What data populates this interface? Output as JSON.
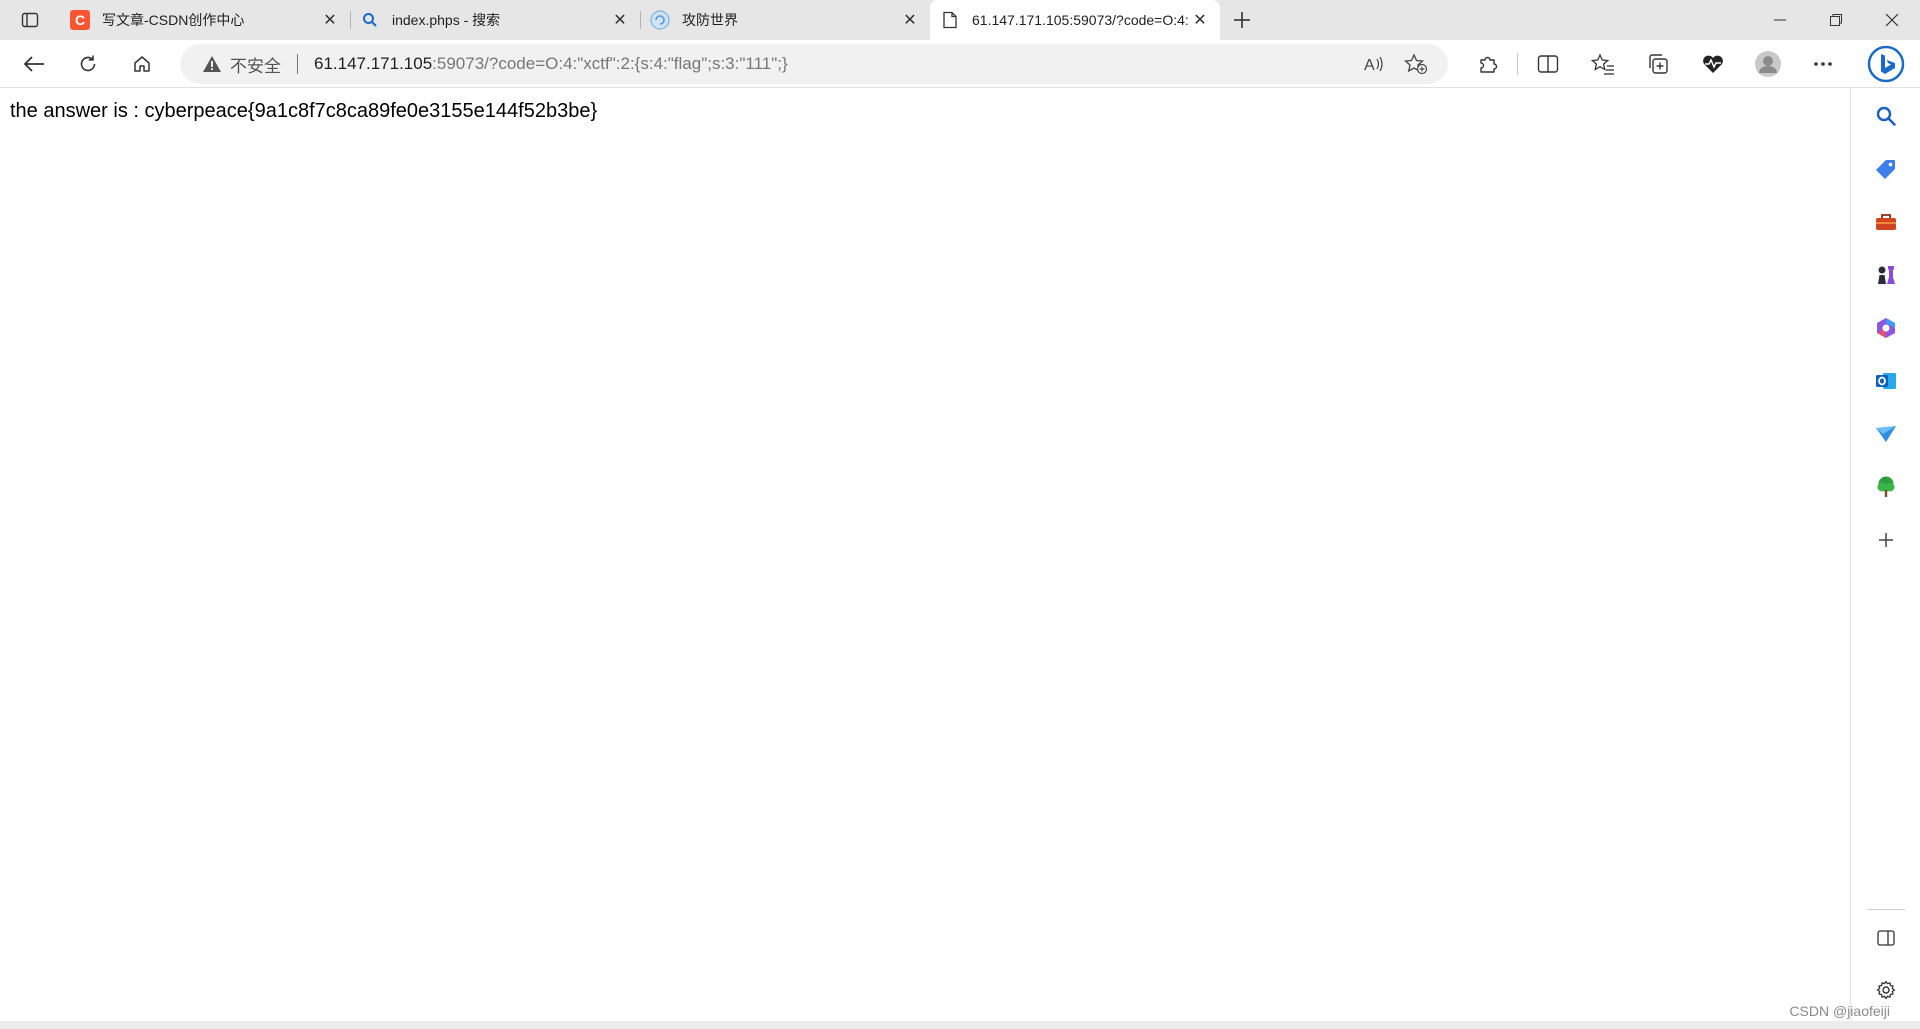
{
  "tabs": [
    {
      "title": "写文章-CSDN创作中心",
      "favicon": "csdn-icon",
      "active": false
    },
    {
      "title": "index.phps - 搜索",
      "favicon": "search-icon",
      "active": false
    },
    {
      "title": "攻防世界",
      "favicon": "adworld-icon",
      "active": false
    },
    {
      "title": "61.147.171.105:59073/?code=O:4:",
      "favicon": "page-icon",
      "active": true
    }
  ],
  "address_bar": {
    "security_label": "不安全",
    "host": "61.147.171.105",
    "rest": ":59073/?code=O:4:\"xctf\":2:{s:4:\"flag\";s:3:\"111\";}"
  },
  "page": {
    "text": "the answer is : cyberpeace{9a1c8f7c8ca89fe0e3155e144f52b3be}"
  },
  "watermark": "CSDN @jiaofeiji",
  "colors": {
    "csdn_red": "#fc5531",
    "bing_blue": "#1b6ac9",
    "tabstrip_bg": "#e6e6e6"
  }
}
